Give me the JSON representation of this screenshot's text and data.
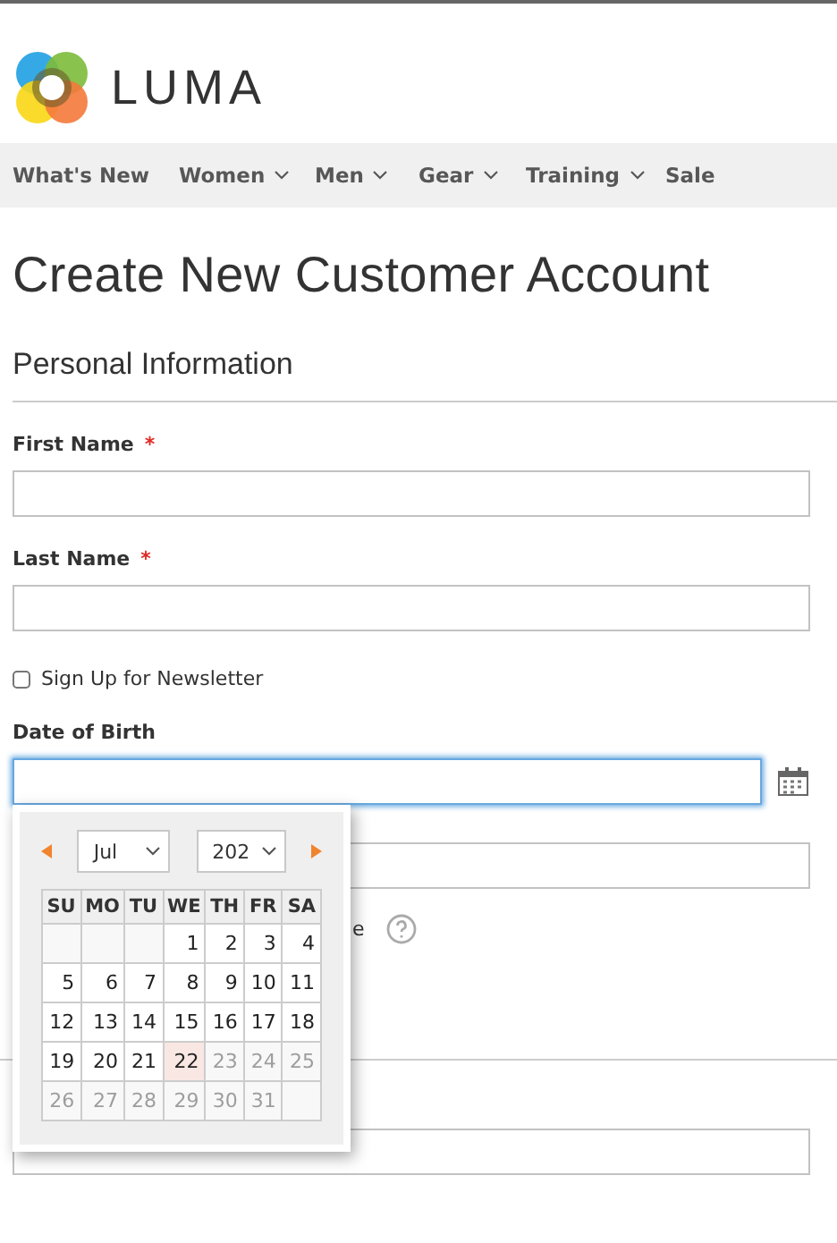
{
  "logo": {
    "text": "LUMA"
  },
  "nav": [
    {
      "label": "What's New",
      "dropdown": false
    },
    {
      "label": "Women",
      "dropdown": true
    },
    {
      "label": "Men",
      "dropdown": true
    },
    {
      "label": "Gear",
      "dropdown": true
    },
    {
      "label": "Training",
      "dropdown": true
    },
    {
      "label": "Sale",
      "dropdown": false
    }
  ],
  "title": "Create New Customer Account",
  "section": "Personal Information",
  "fields": [
    {
      "label": "First Name",
      "required_mark": "*"
    },
    {
      "label": "Last Name",
      "required_mark": "*"
    }
  ],
  "newsletter": {
    "label": "Sign Up for Newsletter",
    "checked": false
  },
  "dob": {
    "label": "Date of Birth",
    "focused": true
  },
  "partial_text": "e",
  "datepicker": {
    "month": "Jul",
    "year": "202",
    "weekdays": [
      "SU",
      "MO",
      "TU",
      "WE",
      "TH",
      "FR",
      "SA"
    ],
    "weeks": [
      [
        {
          "kind": "empty"
        },
        {
          "kind": "empty"
        },
        {
          "kind": "empty"
        },
        {
          "kind": "day",
          "label": "1",
          "today": false,
          "disabled": false
        },
        {
          "kind": "day",
          "label": "2",
          "today": false,
          "disabled": false
        },
        {
          "kind": "day",
          "label": "3",
          "today": false,
          "disabled": false
        },
        {
          "kind": "day",
          "label": "4",
          "today": false,
          "disabled": false
        }
      ],
      [
        {
          "kind": "day",
          "label": "5",
          "today": false,
          "disabled": false
        },
        {
          "kind": "day",
          "label": "6",
          "today": false,
          "disabled": false
        },
        {
          "kind": "day",
          "label": "7",
          "today": false,
          "disabled": false
        },
        {
          "kind": "day",
          "label": "8",
          "today": false,
          "disabled": false
        },
        {
          "kind": "day",
          "label": "9",
          "today": false,
          "disabled": false
        },
        {
          "kind": "day",
          "label": "10",
          "today": false,
          "disabled": false
        },
        {
          "kind": "day",
          "label": "11",
          "today": false,
          "disabled": false
        }
      ],
      [
        {
          "kind": "day",
          "label": "12",
          "today": false,
          "disabled": false
        },
        {
          "kind": "day",
          "label": "13",
          "today": false,
          "disabled": false
        },
        {
          "kind": "day",
          "label": "14",
          "today": false,
          "disabled": false
        },
        {
          "kind": "day",
          "label": "15",
          "today": false,
          "disabled": false
        },
        {
          "kind": "day",
          "label": "16",
          "today": false,
          "disabled": false
        },
        {
          "kind": "day",
          "label": "17",
          "today": false,
          "disabled": false
        },
        {
          "kind": "day",
          "label": "18",
          "today": false,
          "disabled": false
        }
      ],
      [
        {
          "kind": "day",
          "label": "19",
          "today": false,
          "disabled": false
        },
        {
          "kind": "day",
          "label": "20",
          "today": false,
          "disabled": false
        },
        {
          "kind": "day",
          "label": "21",
          "today": false,
          "disabled": false
        },
        {
          "kind": "day",
          "label": "22",
          "today": true,
          "disabled": false
        },
        {
          "kind": "day",
          "label": "23",
          "today": false,
          "disabled": true
        },
        {
          "kind": "day",
          "label": "24",
          "today": false,
          "disabled": true
        },
        {
          "kind": "day",
          "label": "25",
          "today": false,
          "disabled": true
        }
      ],
      [
        {
          "kind": "day",
          "label": "26",
          "today": false,
          "disabled": true
        },
        {
          "kind": "day",
          "label": "27",
          "today": false,
          "disabled": true
        },
        {
          "kind": "day",
          "label": "28",
          "today": false,
          "disabled": true
        },
        {
          "kind": "day",
          "label": "29",
          "today": false,
          "disabled": true
        },
        {
          "kind": "day",
          "label": "30",
          "today": false,
          "disabled": true
        },
        {
          "kind": "day",
          "label": "31",
          "today": false,
          "disabled": true
        },
        {
          "kind": "empty"
        }
      ]
    ]
  }
}
